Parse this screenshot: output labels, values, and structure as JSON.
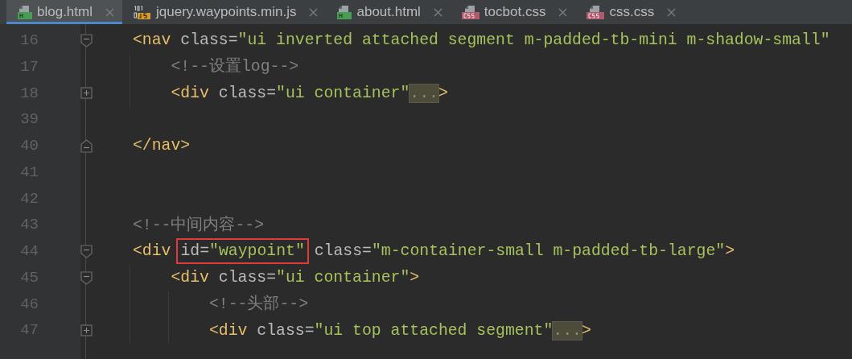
{
  "tabs": [
    {
      "label": "blog.html",
      "kind": "html",
      "selected": true
    },
    {
      "label": "jquery.waypoints.min.js",
      "kind": "js",
      "selected": false
    },
    {
      "label": "about.html",
      "kind": "html",
      "selected": false
    },
    {
      "label": "tocbot.css",
      "kind": "css",
      "selected": false
    },
    {
      "label": "css.css",
      "kind": "css",
      "selected": false
    }
  ],
  "lines": [
    {
      "number": "16",
      "kind": "fold_start",
      "tokens": [
        {
          "kind": "tag",
          "text": "<nav"
        },
        {
          "kind": "attr",
          "text": " class="
        },
        {
          "kind": "value",
          "text": "\"ui inverted attached segment m-padded-tb-mini m-shadow-small\""
        }
      ]
    },
    {
      "number": "17",
      "kind": "plain",
      "tokens": [
        {
          "kind": "comment",
          "text": "    <!--设置log-->"
        }
      ]
    },
    {
      "number": "18",
      "kind": "folded",
      "tokens": [
        {
          "kind": "tag",
          "text": "    <div"
        },
        {
          "kind": "attr",
          "text": " class="
        },
        {
          "kind": "value",
          "text": "\"ui container\""
        },
        {
          "kind": "folded",
          "text": "..."
        },
        {
          "kind": "tag",
          "text": ">"
        }
      ]
    },
    {
      "number": "39",
      "kind": "plain"
    },
    {
      "number": "40",
      "kind": "fold_end",
      "tokens": [
        {
          "kind": "tag",
          "text": "</nav>"
        }
      ]
    },
    {
      "number": "41",
      "kind": "plain"
    },
    {
      "number": "42",
      "kind": "plain"
    },
    {
      "number": "43",
      "kind": "plain",
      "tokens": [
        {
          "kind": "comment",
          "text": "<!--中间内容-->"
        }
      ]
    },
    {
      "number": "44",
      "kind": "fold_start",
      "tokens": [
        {
          "kind": "tag",
          "text": "<div"
        },
        {
          "kind": "boxed",
          "tokens": [
            {
              "kind": "attr",
              "text": "id="
            },
            {
              "kind": "value",
              "text": "\"waypoint\""
            }
          ]
        },
        {
          "kind": "attr",
          "text": " class="
        },
        {
          "kind": "value",
          "text": "\"m-container-small m-padded-tb-large\""
        },
        {
          "kind": "tag",
          "text": ">"
        }
      ]
    },
    {
      "number": "45",
      "kind": "fold_start",
      "tokens": [
        {
          "kind": "tag",
          "text": "    <div"
        },
        {
          "kind": "attr",
          "text": " class="
        },
        {
          "kind": "value",
          "text": "\"ui container\""
        },
        {
          "kind": "tag",
          "text": ">"
        }
      ]
    },
    {
      "number": "46",
      "kind": "plain",
      "tokens": [
        {
          "kind": "comment",
          "text": "        <!--头部-->"
        }
      ]
    },
    {
      "number": "47",
      "kind": "folded",
      "tokens": [
        {
          "kind": "tag",
          "text": "        <div"
        },
        {
          "kind": "attr",
          "text": " class="
        },
        {
          "kind": "value",
          "text": "\"ui top attached segment\""
        },
        {
          "kind": "folded",
          "text": "..."
        },
        {
          "kind": "tag",
          "text": ">"
        }
      ]
    }
  ]
}
